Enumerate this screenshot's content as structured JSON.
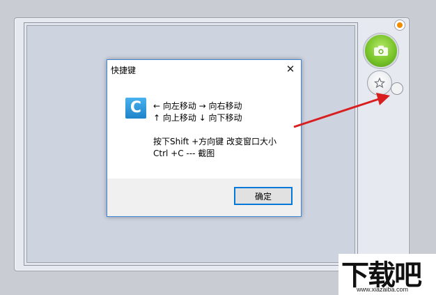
{
  "dialog": {
    "title": "快捷键",
    "close_glyph": "✕",
    "icon_letter": "C",
    "lines": [
      "←  向左移动   →  向右移动",
      "↑  向上移动   ↓  向下移动",
      "按下Shift +方向键 改变窗口大小",
      "Ctrl +C --- 截图"
    ],
    "ok_label": "确定"
  },
  "watermark": {
    "text": "下载吧",
    "url": "www.xiazaiba.com"
  },
  "colors": {
    "accent": "#0078d7",
    "arrow": "#d81e1e",
    "camera_green": "#79c52a",
    "info_orange": "#f08c00"
  },
  "icons": [
    "info-icon",
    "camera-icon",
    "star-icon",
    "close-icon",
    "app-icon"
  ]
}
